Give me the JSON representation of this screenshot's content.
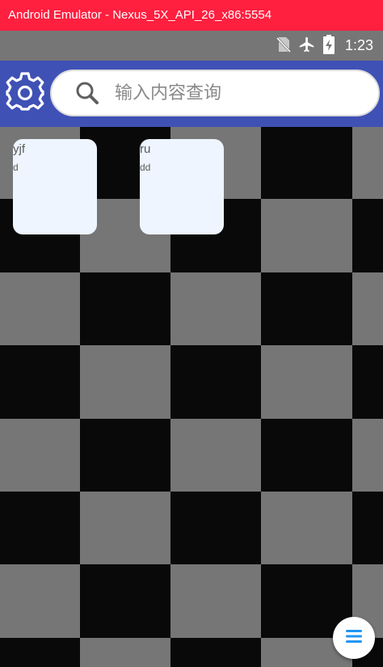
{
  "window": {
    "title": "Android Emulator - Nexus_5X_API_26_x86:5554"
  },
  "status_bar": {
    "time": "1:23",
    "icons": [
      "no-sim-icon",
      "airplane-mode-icon",
      "battery-charging-icon"
    ]
  },
  "app_bar": {
    "settings_icon": "gear-icon",
    "search": {
      "icon": "search-icon",
      "placeholder": "输入内容查询",
      "value": ""
    },
    "color": "#3f51b5"
  },
  "board": {
    "dark_color": "#090909",
    "light_color": "#767676"
  },
  "cards": [
    {
      "title": "yjf",
      "subtitle": "d"
    },
    {
      "title": "ru",
      "subtitle": "dd"
    }
  ],
  "fab": {
    "icon": "menu-icon",
    "icon_color": "#2196f3"
  }
}
